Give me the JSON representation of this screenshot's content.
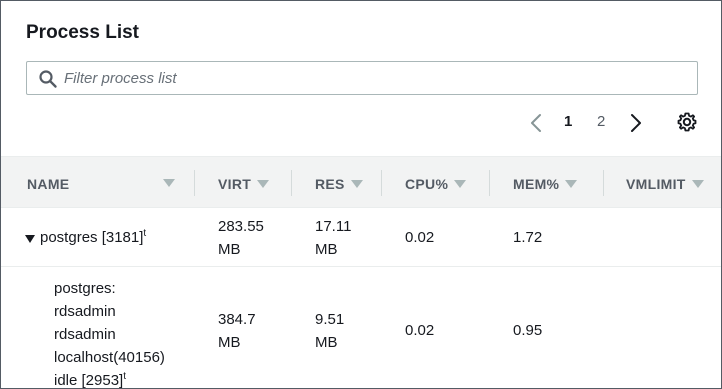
{
  "panel": {
    "title": "Process List"
  },
  "search": {
    "placeholder": "Filter process list",
    "value": ""
  },
  "pagination": {
    "pages": [
      "1",
      "2"
    ],
    "current": "1"
  },
  "table": {
    "columns": [
      "NAME",
      "VIRT",
      "RES",
      "CPU%",
      "MEM%",
      "VMLIMIT"
    ],
    "rows": [
      {
        "name_lines": [
          "postgres [3181]"
        ],
        "name_suffix": "t",
        "virt_lines": [
          "283.55",
          "MB"
        ],
        "res_lines": [
          "17.11",
          "MB"
        ],
        "cpu": "0.02",
        "mem": "1.72",
        "vmlimit": ""
      },
      {
        "name_lines": [
          "postgres:",
          "rdsadmin",
          "rdsadmin",
          "localhost(40156)",
          "idle [2953]"
        ],
        "name_suffix": "t",
        "virt_lines": [
          "384.7",
          "MB"
        ],
        "res_lines": [
          "9.51",
          "MB"
        ],
        "cpu": "0.02",
        "mem": "0.95",
        "vmlimit": ""
      }
    ]
  },
  "icons": {
    "search": "search-icon",
    "prev": "chevron-left-icon",
    "next": "chevron-right-icon",
    "settings": "gear-icon",
    "expand": "caret-down-icon"
  },
  "colors": {
    "text": "#16191f",
    "muted": "#545b64",
    "header_bg": "#f2f3f3",
    "border": "#aab7b8"
  }
}
